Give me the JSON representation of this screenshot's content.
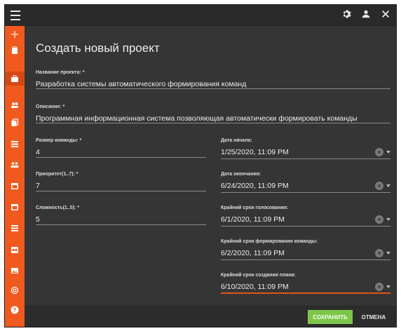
{
  "page": {
    "title": "Создать новый проект"
  },
  "sidebar": {
    "items": [
      {
        "icon": "plus-icon"
      },
      {
        "icon": "clipboard-icon"
      },
      {
        "icon": "briefcase-icon"
      },
      {
        "icon": "group-icon"
      },
      {
        "icon": "copy-icon"
      },
      {
        "icon": "list-icon"
      },
      {
        "icon": "team-icon"
      },
      {
        "icon": "calendar-icon"
      },
      {
        "icon": "calendar-icon"
      },
      {
        "icon": "list-icon"
      },
      {
        "icon": "calendar-icon"
      },
      {
        "icon": "image-icon"
      },
      {
        "icon": "at-icon"
      },
      {
        "icon": "help-icon"
      }
    ],
    "active_index": 2
  },
  "form": {
    "project_name": {
      "label": "Название проекта: *",
      "value": "Разработка системы автоматического формирования команд"
    },
    "description": {
      "label": "Описание: *",
      "value": "Программная информационная система позволяющая автоматически формировать команды"
    },
    "team_size": {
      "label": "Размер команды: *",
      "value": "4"
    },
    "priority": {
      "label": "Приоритет(1..7): *",
      "value": "7"
    },
    "complexity": {
      "label": "Сложность(1..5): *",
      "value": "5"
    },
    "start_date": {
      "label": "Дата начала:",
      "value": "1/25/2020, 11:09 PM"
    },
    "end_date": {
      "label": "Дата окончания:",
      "value": "6/24/2020, 11:09 PM"
    },
    "voting_deadline": {
      "label": "Крайний срок голосования:",
      "value": "6/1/2020, 11:09 PM"
    },
    "team_formation_deadline": {
      "label": "Крайний срок формирования команды:",
      "value": "6/2/2020, 11:09 PM"
    },
    "plan_deadline": {
      "label": "Крайний срок создания плана:",
      "value": "6/10/2020, 11:09 PM"
    }
  },
  "footer": {
    "save_label": "СОХРАНИТЬ",
    "cancel_label": "ОТМЕНА"
  },
  "colors": {
    "accent": "#f05a1e",
    "save": "#7ec64a",
    "background": "#353535"
  }
}
